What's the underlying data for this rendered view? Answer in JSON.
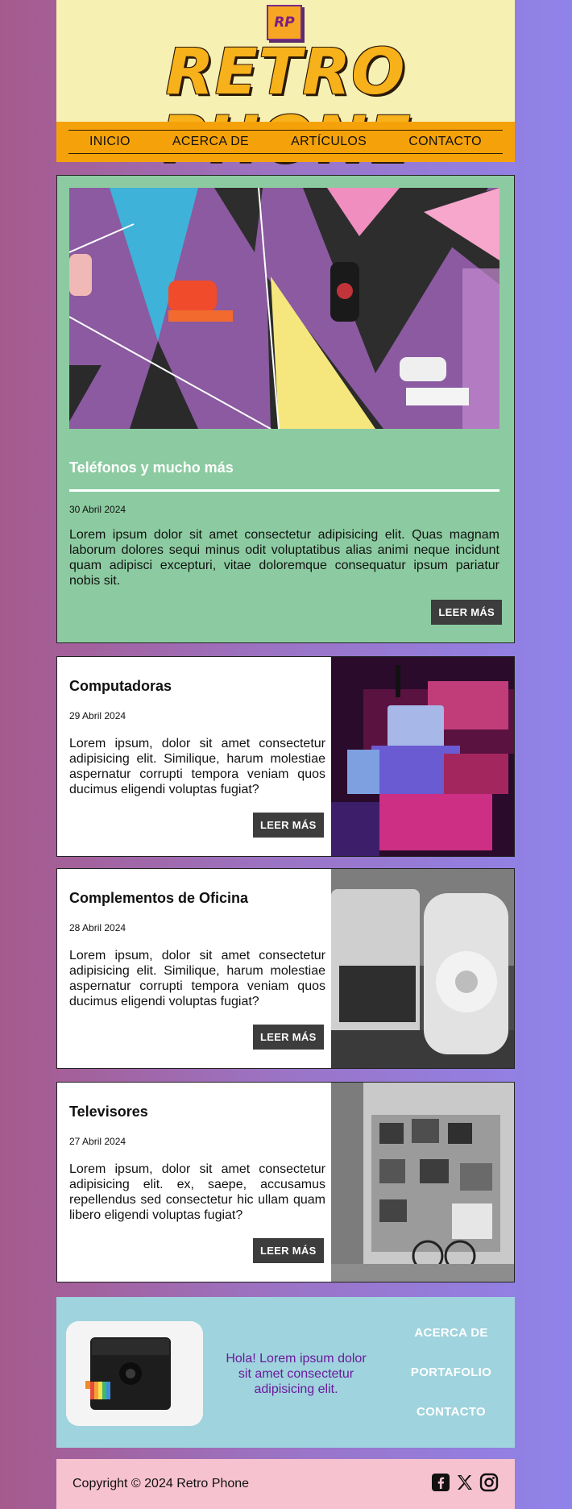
{
  "header": {
    "logo_badge": "RP",
    "brand": "RETRO PHONE"
  },
  "nav": {
    "items": [
      "INICIO",
      "ACERCA DE",
      "ARTÍCULOS",
      "CONTACTO"
    ]
  },
  "featured": {
    "title": "Teléfonos y mucho más",
    "date": "30 Abril 2024",
    "text": "Lorem ipsum dolor sit amet consectetur adipisicing elit. Quas magnam laborum dolores sequi minus odit voluptatibus alias animi neque incidunt quam adipisci excepturi, vitae doloremque consequatur ipsum pariatur nobis sit.",
    "button": "LEER MÁS"
  },
  "cards": [
    {
      "title": "Computadoras",
      "date": "29 Abril 2024",
      "text": "Lorem ipsum, dolor sit amet consectetur adipisicing elit. Similique, harum molestiae aspernatur corrupti tempora veniam quos ducimus eligendi voluptas fugiat?",
      "button": "LEER MÁS"
    },
    {
      "title": "Complementos de Oficina",
      "date": "28 Abril 2024",
      "text": "Lorem ipsum, dolor sit amet consectetur adipisicing elit. Similique, harum molestiae aspernatur corrupti tempora veniam quos ducimus eligendi voluptas fugiat?",
      "button": "LEER MÁS"
    },
    {
      "title": "Televisores",
      "date": "27 Abril 2024",
      "text": "Lorem ipsum, dolor sit amet consectetur adipisicing elit. ex, saepe, accusamus repellendus sed consectetur hic ullam quam libero eligendi voluptas fugiat?",
      "button": "LEER MÁS"
    }
  ],
  "footer": {
    "message": "Hola! Lorem ipsum dolor sit amet consectetur adipisicing elit.",
    "links": [
      "ACERCA DE",
      "PORTAFOLIO",
      "CONTACTO"
    ]
  },
  "bottom": {
    "copyright": "Copyright © 2024 Retro Phone",
    "social_icons": [
      "facebook-icon",
      "x-icon",
      "instagram-icon"
    ]
  },
  "colors": {
    "header_bg": "#f7f0b3",
    "nav_bg": "#f5a20a",
    "featured_bg": "#8ccba1",
    "footer_bg": "#9fd3de",
    "bottom_bg": "#f7c2d0",
    "button_bg": "#3d3d3d",
    "brand_text": "#f7b11a",
    "footer_message": "#6a1b9a"
  }
}
